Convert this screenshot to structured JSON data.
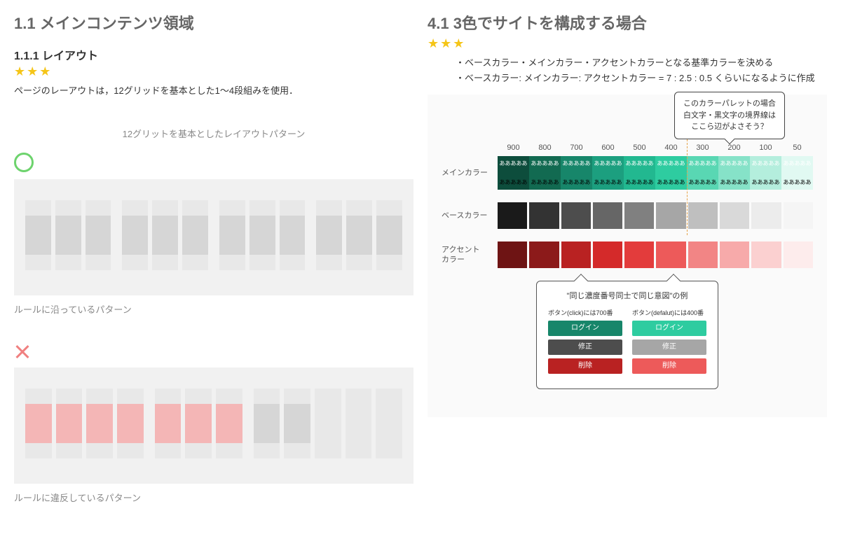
{
  "left": {
    "sectionTitle": "1.1 メインコンテンツ領域",
    "subsectionTitle": "1.1.1 レイアウト",
    "stars": "★★★",
    "bodyText": "ページのレーアウトは，12グリッドを基本とした1～4段組みを使用．",
    "caption": "12グリットを基本としたレイアウトパターン",
    "okLabel": "ルールに沿っているパターン",
    "ngLabel": "ルールに違反しているパターン",
    "okGroups": [
      3,
      3,
      3,
      3
    ],
    "ngGroups": [
      4,
      3,
      2
    ]
  },
  "right": {
    "sectionTitle": "4.1 3色でサイトを構成する場合",
    "stars": "★★★",
    "bullets": [
      "・ベースカラー・メインカラー・アクセントカラーとなる基準カラーを決める",
      "・ベースカラー: メインカラー: アクセントカラー = 7 : 2.5 : 0.5 くらいになるように作成"
    ],
    "tooltipTop": "このカラーパレットの場合\n白文字・黒文字の境界線は\nここら辺がよさそう？",
    "shades": [
      "900",
      "800",
      "700",
      "600",
      "500",
      "400",
      "300",
      "200",
      "100",
      "50"
    ],
    "rows": {
      "main": {
        "label": "メインカラー",
        "txt": "あああああ",
        "colors": [
          "#0d4d3c",
          "#126a51",
          "#17866a",
          "#1c9f7f",
          "#22b890",
          "#2ecca0",
          "#59d7b3",
          "#86e2c8",
          "#b4eedd",
          "#e1f9f2"
        ]
      },
      "base": {
        "label": "ベースカラー",
        "colors": [
          "#1a1a1a",
          "#333333",
          "#4d4d4d",
          "#666666",
          "#808080",
          "#a6a6a6",
          "#bfbfbf",
          "#d9d9d9",
          "#ececec",
          "#f5f5f5"
        ]
      },
      "accent": {
        "label": "アクセント\nカラー",
        "colors": [
          "#6e1414",
          "#8c1a1a",
          "#b92222",
          "#d42a2a",
          "#e33c3c",
          "#ed5a5a",
          "#f28585",
          "#f7aaaa",
          "#fbd0d0",
          "#fdecec"
        ]
      }
    },
    "example": {
      "title": "\"同じ濃度番号同士で同じ意図\"の例",
      "colLeft": {
        "cap": "ボタン(click)には700番",
        "buttons": [
          {
            "t": "ログイン",
            "c": "#17866a"
          },
          {
            "t": "修正",
            "c": "#4d4d4d"
          },
          {
            "t": "削除",
            "c": "#b92222"
          }
        ]
      },
      "colRight": {
        "cap": "ボタン(defalut)には400番",
        "buttons": [
          {
            "t": "ログイン",
            "c": "#2ecca0"
          },
          {
            "t": "修正",
            "c": "#a6a6a6"
          },
          {
            "t": "削除",
            "c": "#ed5a5a"
          }
        ]
      }
    }
  }
}
